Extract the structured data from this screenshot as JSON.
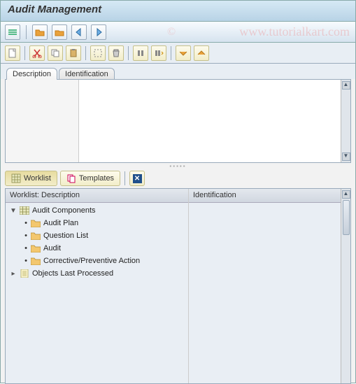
{
  "title": "Audit Management",
  "watermark_c": "©",
  "watermark_text": "www.tutorialkart.com",
  "upper_tabs": {
    "t1": "Description",
    "t2": "Identification"
  },
  "mid_buttons": {
    "worklist": "Worklist",
    "templates": "Templates"
  },
  "lower_headers": {
    "c1": "Worklist: Description",
    "c2": "Identification"
  },
  "tree": {
    "n1": "Audit Components",
    "n1_1": "Audit Plan",
    "n1_2": "Question List",
    "n1_3": "Audit",
    "n1_4": "Corrective/Preventive Action",
    "n2": "Objects Last Processed"
  },
  "glyph": {
    "exp_down": "▼",
    "exp_right": "▸",
    "bullet": "•",
    "arrow_up": "▲",
    "arrow_dn": "▼"
  }
}
